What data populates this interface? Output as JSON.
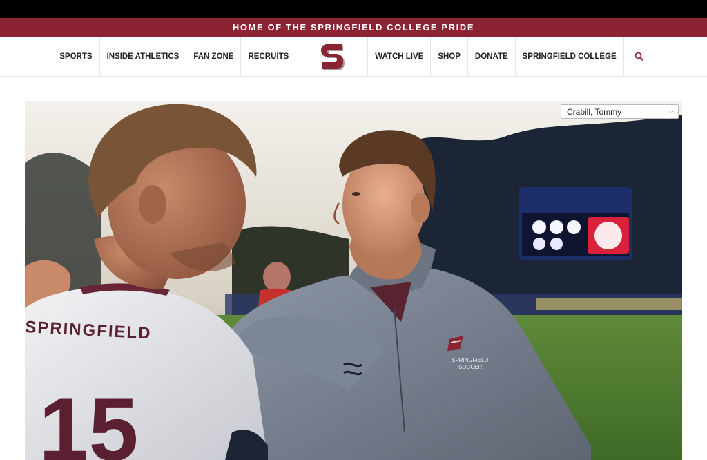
{
  "banner": {
    "text": "HOME OF THE SPRINGFIELD COLLEGE PRIDE"
  },
  "nav": {
    "left": [
      "SPORTS",
      "INSIDE ATHLETICS",
      "FAN ZONE",
      "RECRUITS"
    ],
    "right": [
      "WATCH LIVE",
      "SHOP",
      "DONATE",
      "SPRINGFIELD COLLEGE"
    ],
    "logo": "springfield-s-logo",
    "search_icon": "search-icon"
  },
  "hero": {
    "jersey_text": "SPRINGFIELD",
    "jersey_number": "15",
    "jacket_text_line1": "SPRINGFIELD",
    "jacket_text_line2": "SOCCER"
  },
  "roster_select": {
    "selected": "Crabill, Tommy"
  },
  "colors": {
    "brand": "#8b2332",
    "nav_text": "#222222"
  }
}
